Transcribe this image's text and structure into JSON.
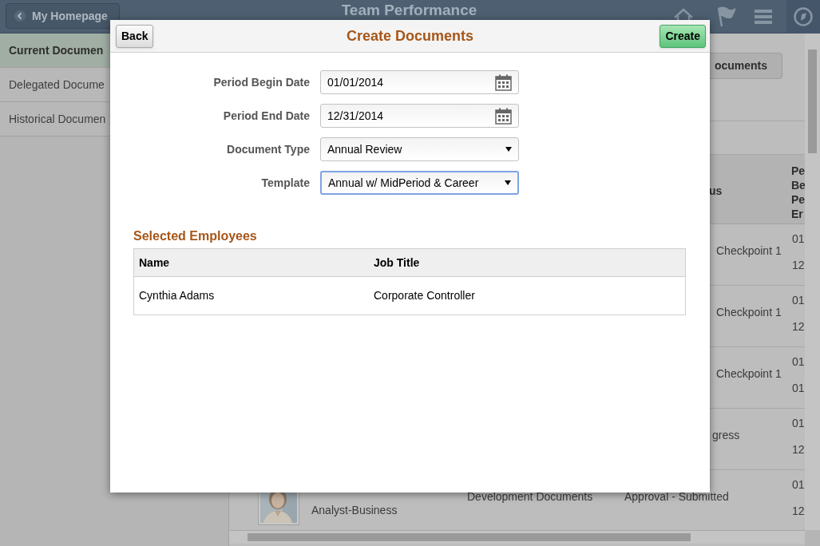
{
  "background_page": {
    "header": {
      "home_button": "My Homepage",
      "title": "Team Performance"
    },
    "sidebar": {
      "items": [
        {
          "label": "Current Documen",
          "selected": true
        },
        {
          "label": "Delegated Docume",
          "selected": false
        },
        {
          "label": "Historical Documen",
          "selected": false
        }
      ]
    },
    "action_button": "ocuments",
    "table": {
      "status_header": "us",
      "date_header_lines": [
        "Pe",
        "Be",
        "Pe",
        "Er"
      ],
      "rows": [
        {
          "status": "Checkpoint 1",
          "dates": [
            "01",
            "12"
          ]
        },
        {
          "status": "Checkpoint 1",
          "dates": [
            "01",
            "12"
          ]
        },
        {
          "status": "Checkpoint 1",
          "dates": [
            "01",
            "01"
          ]
        },
        {
          "status": "gress",
          "dates": [
            "01",
            "12"
          ]
        },
        {
          "photo": {
            "kind": "picture"
          },
          "job_title": "Analyst-Business",
          "document_type": "Development Documents",
          "status": "Approval - Submitted",
          "dates": [
            "01",
            "12"
          ]
        }
      ]
    }
  },
  "modal": {
    "back_button": "Back",
    "title": "Create Documents",
    "create_button": "Create",
    "fields": [
      {
        "label": "Period Begin Date",
        "value": "01/01/2014",
        "kind": "date",
        "focused": false
      },
      {
        "label": "Period End Date",
        "value": "12/31/2014",
        "kind": "date",
        "focused": false
      },
      {
        "label": "Document Type",
        "value": "Annual Review",
        "kind": "select",
        "focused": false
      },
      {
        "label": "Template",
        "value": "Annual w/ MidPeriod & Career",
        "kind": "select",
        "focused": true
      }
    ],
    "selected_employees": {
      "title": "Selected Employees",
      "columns": [
        "Name",
        "Job Title"
      ],
      "rows": [
        [
          "Cynthia Adams",
          "Corporate Controller"
        ]
      ]
    }
  }
}
